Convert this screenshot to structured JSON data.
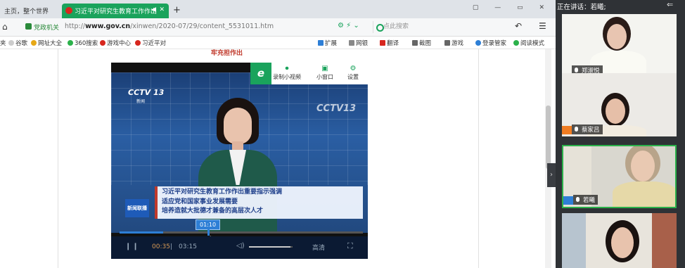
{
  "browser": {
    "tabs": [
      {
        "label": "主页，整个世界"
      },
      {
        "label": "习近平对研究生教育工作作出"
      }
    ],
    "new_tab": "+",
    "window_controls": "▢ — ▭ ✕",
    "address": {
      "site_badge": "党政机关",
      "url_prefix": "http://",
      "url_domain": "www.gov.cn",
      "url_path": "/xinwen/2020-07/29/content_5531011.htm",
      "search_placeholder": "点此搜索"
    },
    "bookmarks": [
      "夹",
      "谷歌",
      "网址大全",
      "360搜索",
      "游戏中心",
      "习近平对",
      "扩展",
      "网银",
      "翻译",
      "截图",
      "游戏",
      "登录管家",
      "阅读模式"
    ]
  },
  "page": {
    "heading": "牢充担作出"
  },
  "player": {
    "toolbar_logo": "e",
    "toolbar": [
      {
        "label": "录制小视频",
        "icon": "record-icon"
      },
      {
        "label": "小窗口",
        "icon": "mini-window-icon"
      },
      {
        "label": "设置",
        "icon": "settings-icon"
      }
    ],
    "channel_logo": "CCTV 13",
    "channel_sub": "新闻",
    "watermark": "CCTV13",
    "news_logo": "新闻联播",
    "caption_lines": [
      "习近平对研究生教育工作作出重要指示强调",
      "适应党和国家事业发展需要",
      "培养造就大批德才兼备的高层次人才"
    ],
    "tooltip_time": "01:10",
    "current_time": "00:35",
    "separator": "|",
    "total_time": "03:15",
    "quality": "高清",
    "progress_fraction": 0.18,
    "hover_fraction": 0.36,
    "volume_fraction": 0.95
  },
  "meeting": {
    "speaking_label": "正在讲话：若曦;",
    "participants": [
      {
        "name": "郑淑悦"
      },
      {
        "name": "蔡家吕"
      },
      {
        "name": "若曦"
      }
    ]
  }
}
